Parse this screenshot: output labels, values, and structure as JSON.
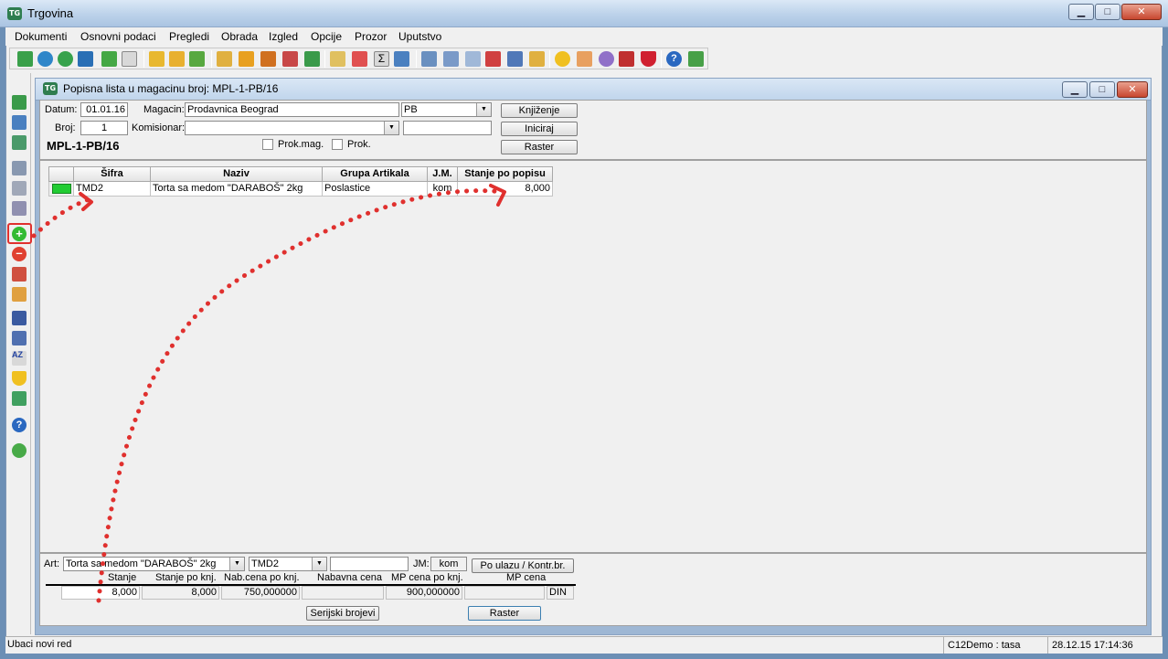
{
  "window": {
    "title": "Trgovina",
    "minimize": "▁",
    "maximize": "□",
    "close": "✕"
  },
  "app_logo_text": "TG",
  "menu": [
    "Dokumenti",
    "Osnovni podaci",
    "Pregledi",
    "Obrada",
    "Izgled",
    "Opcije",
    "Prozor",
    "Uputstvo"
  ],
  "inner_window": {
    "title": "Popisna lista u magacinu broj: MPL-1-PB/16"
  },
  "header": {
    "datum_label": "Datum:",
    "datum_value": "01.01.16",
    "magacin_label": "Magacin:",
    "magacin_value": "Prodavnica Beograd",
    "magacin_code": "PB",
    "broj_label": "Broj:",
    "broj_value": "1",
    "komisionar_label": "Komisionar:",
    "komisionar_value": "",
    "komisionar_extra": "",
    "doc_number": "MPL-1-PB/16",
    "prok_mag_label": "Prok.mag.",
    "prok_label": "Prok.",
    "btn_knjizenje": "Knjiženje",
    "btn_iniciraj": "Iniciraj",
    "btn_raster": "Raster"
  },
  "grid": {
    "columns": [
      "Šifra",
      "Naziv",
      "Grupa Artikala",
      "J.M.",
      "Stanje po popisu"
    ],
    "rows": [
      {
        "sifra": "TMD2",
        "naziv": "Torta sa medom \"DARABOŠ\" 2kg",
        "grupa": "Poslastice",
        "jm": "kom",
        "stanje": "8,000"
      }
    ]
  },
  "bottom": {
    "art_label": "Art:",
    "art_value": "Torta sa medom \"DARABOŠ\" 2kg",
    "art_code": "TMD2",
    "extra_value": "",
    "jm_label": "JM:",
    "jm_value": "kom",
    "btn_po_ulazu": "Po ulazu / Kontr.br.",
    "col_stanje": "Stanje",
    "col_stanje_knj": "Stanje po knj.",
    "col_nab_knj": "Nab.cena po knj.",
    "col_nabavna": "Nabavna cena",
    "col_mp_knj": "MP cena po knj.",
    "col_mp": "MP cena",
    "val_stanje": "8,000",
    "val_stanje_knj": "8,000",
    "val_nab_knj": "750,000000",
    "val_nabavna": "",
    "val_mp_knj": "900,000000",
    "val_mp": "",
    "currency": "DIN",
    "btn_serijski": "Serijski brojevi",
    "btn_raster": "Raster"
  },
  "status": {
    "message": "Ubaci novi red",
    "user": "C12Demo : tasa",
    "datetime": "28.12.15 17:14:36"
  },
  "colors": {
    "annotation_red": "#e0302e",
    "row_marker_green": "#22cc33"
  }
}
